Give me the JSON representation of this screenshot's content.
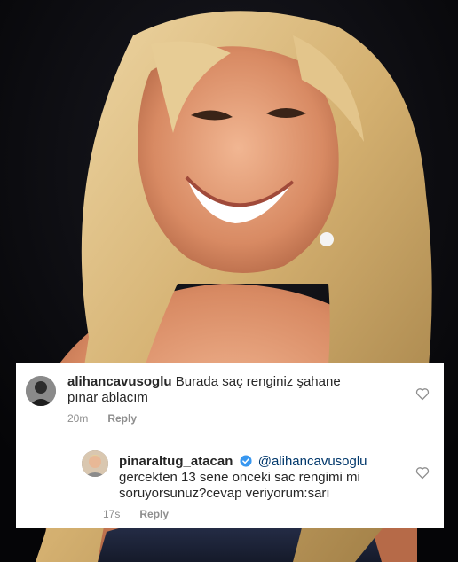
{
  "comments": [
    {
      "username": "alihancavusoglu",
      "text": "Burada saç renginiz şahane pınar ablacım",
      "time": "20m",
      "reply_label": "Reply",
      "icon": "heart-outline-icon"
    },
    {
      "username": "pinaraltug_atacan",
      "verified": true,
      "mention": "@alihancavusoglu",
      "text": "gercekten 13 sene onceki sac rengimi mi soruyorsunuz?cevap veriyorum:sarı",
      "time": "17s",
      "reply_label": "Reply",
      "icon": "heart-outline-icon"
    }
  ],
  "colors": {
    "username": "#262626",
    "mention": "#00376b",
    "meta": "#8e8e8e",
    "verified_badge": "#3897f0",
    "hair": "#e0c48a",
    "background": "#0b0b10"
  }
}
